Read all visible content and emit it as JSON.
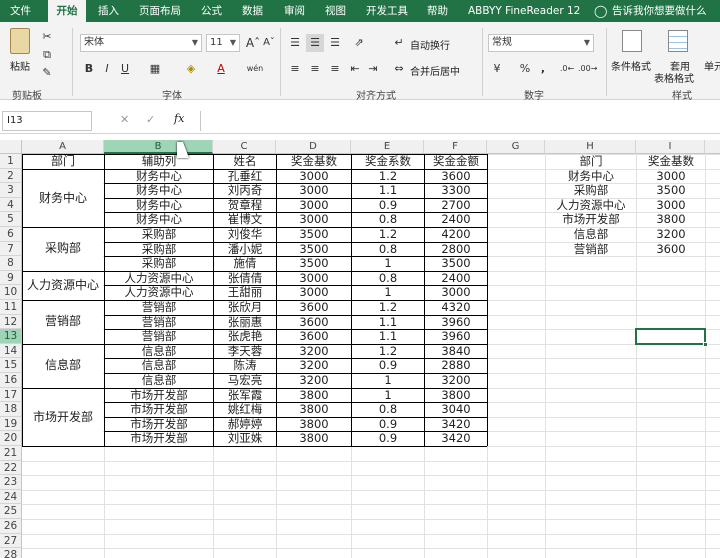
{
  "tabs": [
    "文件",
    "开始",
    "插入",
    "页面布局",
    "公式",
    "数据",
    "审阅",
    "视图",
    "开发工具",
    "帮助",
    "ABBYY FineReader 12"
  ],
  "tell_me": "告诉我你想要做什么",
  "ribbon": {
    "paste": "粘贴",
    "clipboard": "剪贴板",
    "font_name": "宋体",
    "font_size": "11",
    "font_group": "字体",
    "wrap": "自动换行",
    "merge": "合并后居中",
    "align_group": "对齐方式",
    "num_format": "常规",
    "number_group": "数字",
    "cond": "条件格式",
    "table1": "套用",
    "table2": "表格格式",
    "cell_style": "单元",
    "style_group": "样式",
    "bold": "B",
    "italic": "I",
    "underline": "U",
    "pct": "%",
    "comma": ","
  },
  "formula_bar": {
    "name_box": "I13",
    "content": ""
  },
  "columns": [
    "A",
    "B",
    "C",
    "D",
    "E",
    "F",
    "G",
    "H",
    "I"
  ],
  "rows": [
    "1",
    "2",
    "3",
    "4",
    "5",
    "6",
    "7",
    "8",
    "9",
    "10",
    "11",
    "12",
    "13",
    "14",
    "15",
    "16",
    "17",
    "18",
    "19",
    "20",
    "21",
    "22",
    "23",
    "24",
    "25",
    "26",
    "27",
    "28"
  ],
  "dept_merged": [
    "部门",
    "财务中心",
    "采购部",
    "人力资源中心",
    "营销部",
    "信息部",
    "市场开发部"
  ],
  "table": [
    [
      "辅助列",
      "姓名",
      "奖金基数",
      "奖金系数",
      "奖金金额"
    ],
    [
      "财务中心",
      "孔垂红",
      "3000",
      "1.2",
      "3600"
    ],
    [
      "财务中心",
      "刘丙奇",
      "3000",
      "1.1",
      "3300"
    ],
    [
      "财务中心",
      "贺章程",
      "3000",
      "0.9",
      "2700"
    ],
    [
      "财务中心",
      "崔博文",
      "3000",
      "0.8",
      "2400"
    ],
    [
      "采购部",
      "刘俊华",
      "3500",
      "1.2",
      "4200"
    ],
    [
      "采购部",
      "潘小妮",
      "3500",
      "0.8",
      "2800"
    ],
    [
      "采购部",
      "施倩",
      "3500",
      "1",
      "3500"
    ],
    [
      "人力资源中心",
      "张倩倩",
      "3000",
      "0.8",
      "2400"
    ],
    [
      "人力资源中心",
      "王甜丽",
      "3000",
      "1",
      "3000"
    ],
    [
      "营销部",
      "张欣月",
      "3600",
      "1.2",
      "4320"
    ],
    [
      "营销部",
      "张丽惠",
      "3600",
      "1.1",
      "3960"
    ],
    [
      "营销部",
      "张虎艳",
      "3600",
      "1.1",
      "3960"
    ],
    [
      "信息部",
      "李天蓉",
      "3200",
      "1.2",
      "3840"
    ],
    [
      "信息部",
      "陈涛",
      "3200",
      "0.9",
      "2880"
    ],
    [
      "信息部",
      "马宏亮",
      "3200",
      "1",
      "3200"
    ],
    [
      "市场开发部",
      "张军霞",
      "3800",
      "1",
      "3800"
    ],
    [
      "市场开发部",
      "姚红梅",
      "3800",
      "0.8",
      "3040"
    ],
    [
      "市场开发部",
      "郝婷婷",
      "3800",
      "0.9",
      "3420"
    ],
    [
      "市场开发部",
      "刘亚姝",
      "3800",
      "0.9",
      "3420"
    ]
  ],
  "lookup": [
    [
      "部门",
      "奖金基数"
    ],
    [
      "财务中心",
      "3000"
    ],
    [
      "采购部",
      "3500"
    ],
    [
      "人力资源中心",
      "3000"
    ],
    [
      "市场开发部",
      "3800"
    ],
    [
      "信息部",
      "3200"
    ],
    [
      "营销部",
      "3600"
    ]
  ]
}
